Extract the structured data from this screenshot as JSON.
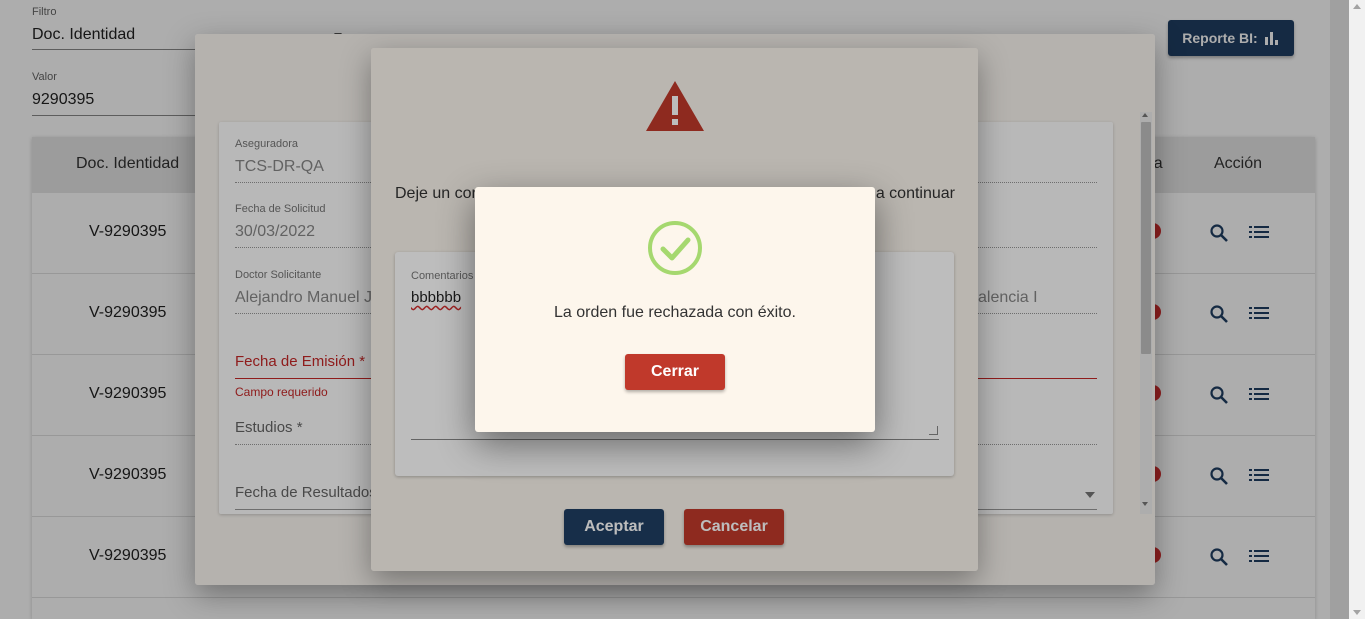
{
  "filter": {
    "label": "Filtro",
    "value": "Doc. Identidad",
    "value_label": "Valor",
    "value_input": "9290395"
  },
  "report_button": {
    "label": "Reporte BI:",
    "icon": "bar-chart-icon"
  },
  "table": {
    "headers": [
      "Doc. Identidad",
      "rta",
      "Acción"
    ],
    "rows": [
      {
        "doc": "V-9290395"
      },
      {
        "doc": "V-9290395"
      },
      {
        "doc": "V-9290395"
      },
      {
        "doc": "V-9290395"
      },
      {
        "doc": "V-9290395"
      }
    ]
  },
  "form": {
    "aseguradora_label": "Aseguradora",
    "aseguradora_value": "TCS-DR-QA",
    "fecha_solicitud_label": "Fecha de Solicitud",
    "fecha_solicitud_value": "30/03/2022",
    "doctor_label": "Doctor Solicitante",
    "doctor_value": "Alejandro Manuel J",
    "doctor_value_tail": "alencia I",
    "fecha_emision_label": "Fecha de Emisión *",
    "fecha_emision_error": "Campo requerido",
    "estudios_label": "Estudios *",
    "fecha_resultados_label": "Fecha de Resultados"
  },
  "comment_modal": {
    "icon": "warning-icon",
    "text_start": "Deje un con",
    "text_end": "a continuar",
    "comment_label": "Comentarios",
    "comment_value": "bbbbbb",
    "accept_label": "Aceptar",
    "cancel_label": "Cancelar"
  },
  "success_modal": {
    "icon": "check-circle-icon",
    "message": "La orden fue rechazada con éxito.",
    "close_label": "Cerrar"
  },
  "colors": {
    "primary": "#1f3f63",
    "danger": "#c0392b",
    "success": "#a5d86f",
    "warning": "#c0392b"
  }
}
